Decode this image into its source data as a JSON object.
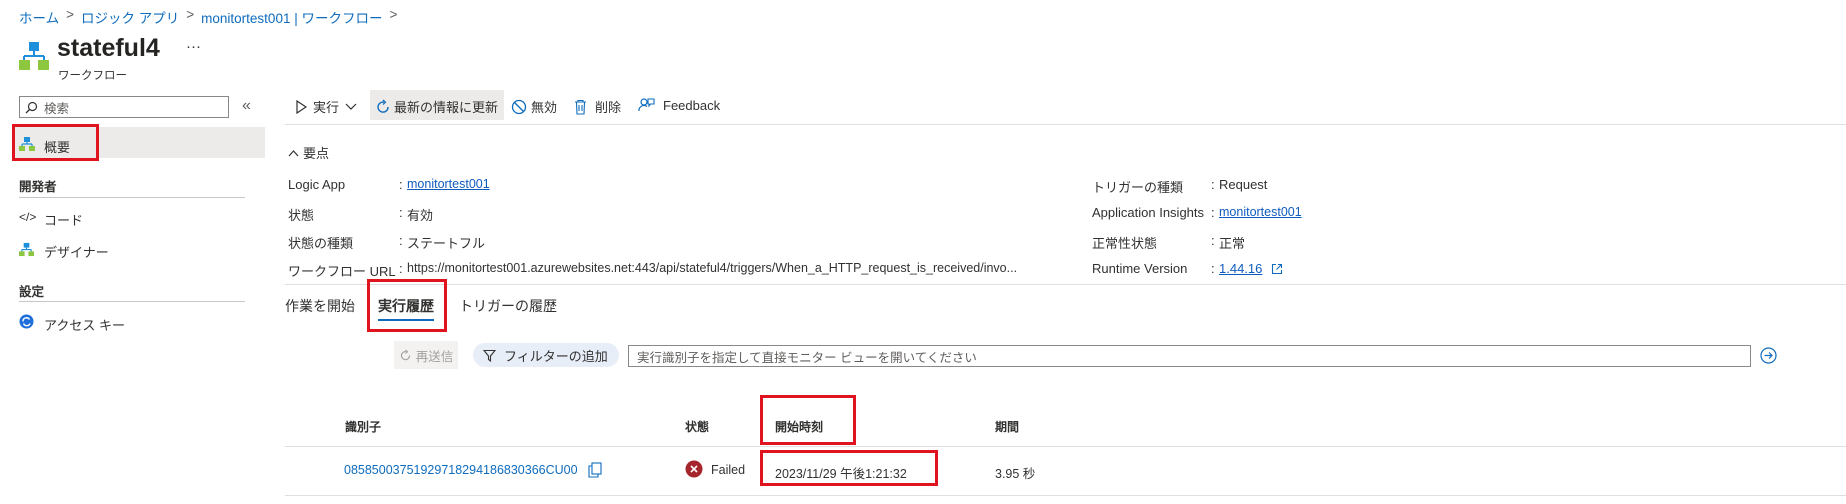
{
  "breadcrumb": {
    "items": [
      "ホーム",
      "ロジック アプリ",
      "monitortest001 | ワークフロー"
    ],
    "separator": ">"
  },
  "header": {
    "title": "stateful4",
    "subtitle": "ワークフロー",
    "more": "···"
  },
  "sidebar": {
    "search_placeholder": "検索",
    "collapse": "«",
    "overview": "概要",
    "section_dev": "開発者",
    "code": "コード",
    "designer": "デザイナー",
    "section_settings": "設定",
    "access_keys": "アクセス キー"
  },
  "toolbar": {
    "run": "実行",
    "refresh": "最新の情報に更新",
    "disable": "無効",
    "delete": "削除",
    "feedback": "Feedback"
  },
  "essentials": {
    "toggle": "要点",
    "left": [
      {
        "label": "Logic App",
        "value": "monitortest001"
      },
      {
        "label": "状態",
        "value": "有効"
      },
      {
        "label": "状態の種類",
        "value": "ステートフル"
      },
      {
        "label": "ワークフロー URL",
        "value": "https://monitortest001.azurewebsites.net:443/api/stateful4/triggers/When_a_HTTP_request_is_received/invo..."
      }
    ],
    "right": [
      {
        "label": "トリガーの種類",
        "value": "Request"
      },
      {
        "label": "Application Insights",
        "value": "monitortest001"
      },
      {
        "label": "正常性状態",
        "value": "正常"
      },
      {
        "label": "Runtime Version",
        "value": "1.44.16"
      }
    ],
    "colon": ":"
  },
  "tabs": [
    "作業を開始",
    "実行履歴",
    "トリガーの履歴"
  ],
  "run_toolbar": {
    "resubmit": "再送信",
    "add_filter": "フィルターの追加",
    "search_placeholder": "実行識別子を指定して直接モニター ビューを開いてください"
  },
  "table": {
    "columns": [
      "識別子",
      "状態",
      "開始時刻",
      "期間"
    ],
    "rows": [
      {
        "id": "08585003751929718294186830366CU00",
        "status": "Failed",
        "start": "2023/11/29 午後1:21:32",
        "duration": "3.95 秒"
      }
    ]
  },
  "colors": {
    "accent": "#0f6cbd",
    "highlight": "#e0141e",
    "failed": "#a4262c",
    "selected_bg": "#edebe9"
  }
}
